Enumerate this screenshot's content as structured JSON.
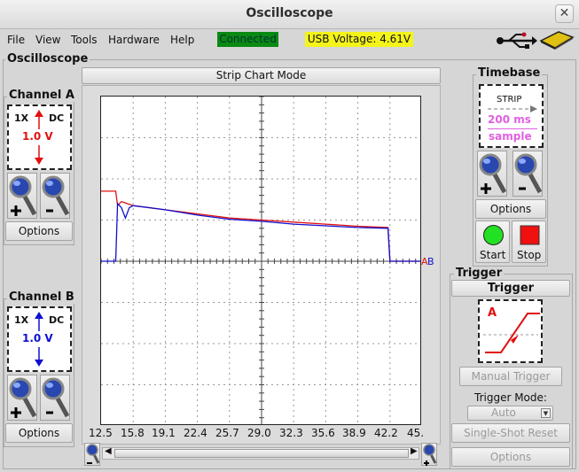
{
  "window": {
    "title": "Oscilloscope",
    "close_glyph": "✕"
  },
  "menu": {
    "file": "File",
    "view": "View",
    "tools": "Tools",
    "hardware": "Hardware",
    "help": "Help"
  },
  "status": {
    "connection": "Connected",
    "usb_voltage": "USB Voltage: 4.61V",
    "connected_color": "#0a8a12",
    "usb_color": "#f4f41a"
  },
  "oscilloscope_label": "Oscilloscope",
  "channel_a": {
    "title": "Channel A",
    "probe": "1X",
    "coupling": "DC",
    "volts_per_div": "1.0 V",
    "color": "#e01010",
    "options": "Options"
  },
  "channel_b": {
    "title": "Channel B",
    "probe": "1X",
    "coupling": "DC",
    "volts_per_div": "1.0 V",
    "color": "#1010d0",
    "options": "Options"
  },
  "display": {
    "mode_title": "Strip Chart Mode",
    "x_ticks": [
      "12.5",
      "15.8",
      "19.1",
      "22.4",
      "25.7",
      "29.0",
      "32.3",
      "35.6",
      "38.9",
      "42.2",
      "45."
    ],
    "marker_a": "A",
    "marker_b": "B"
  },
  "chart_data": {
    "type": "line",
    "x_ticks": [
      "12.5",
      "15.8",
      "19.1",
      "22.4",
      "25.7",
      "29.0",
      "32.3",
      "35.6",
      "38.9",
      "42.2",
      "45."
    ],
    "x_range": [
      12.5,
      45.5
    ],
    "y_range_div": [
      -4,
      4
    ],
    "series": [
      {
        "name": "A",
        "color": "#e01010",
        "points": [
          [
            12.5,
            1.7
          ],
          [
            14.0,
            1.7
          ],
          [
            14.2,
            1.35
          ],
          [
            14.6,
            1.45
          ],
          [
            15.8,
            1.35
          ],
          [
            19.1,
            1.25
          ],
          [
            22.4,
            1.15
          ],
          [
            25.7,
            1.05
          ],
          [
            29.0,
            1.0
          ],
          [
            32.3,
            0.95
          ],
          [
            35.6,
            0.9
          ],
          [
            38.9,
            0.85
          ],
          [
            42.0,
            0.82
          ],
          [
            42.2,
            0.0
          ],
          [
            45.5,
            0.0
          ]
        ]
      },
      {
        "name": "B",
        "color": "#1010d0",
        "points": [
          [
            12.5,
            0.0
          ],
          [
            14.0,
            0.0
          ],
          [
            14.2,
            1.4
          ],
          [
            14.6,
            1.3
          ],
          [
            15.0,
            1.05
          ],
          [
            15.4,
            1.3
          ],
          [
            15.8,
            1.35
          ],
          [
            19.1,
            1.25
          ],
          [
            22.4,
            1.12
          ],
          [
            25.7,
            1.02
          ],
          [
            29.0,
            0.97
          ],
          [
            32.3,
            0.9
          ],
          [
            35.6,
            0.86
          ],
          [
            38.9,
            0.82
          ],
          [
            42.0,
            0.8
          ],
          [
            42.2,
            0.0
          ],
          [
            45.5,
            0.0
          ]
        ]
      }
    ]
  },
  "timebase": {
    "title": "Timebase",
    "mode": "STRIP",
    "time_per_div": "200 ms",
    "unit": "sample",
    "options": "Options",
    "start": "Start",
    "stop": "Stop"
  },
  "trigger": {
    "title": "Trigger",
    "header": "Trigger",
    "channel": "A",
    "manual": "Manual Trigger",
    "mode_label": "Trigger Mode:",
    "mode_value": "Auto",
    "single_shot": "Single-Shot Reset",
    "options": "Options"
  },
  "icons": {
    "usb": "usb-icon",
    "device": "device-icon",
    "zoom_in": "zoom-in-icon",
    "zoom_out": "zoom-out-icon"
  }
}
